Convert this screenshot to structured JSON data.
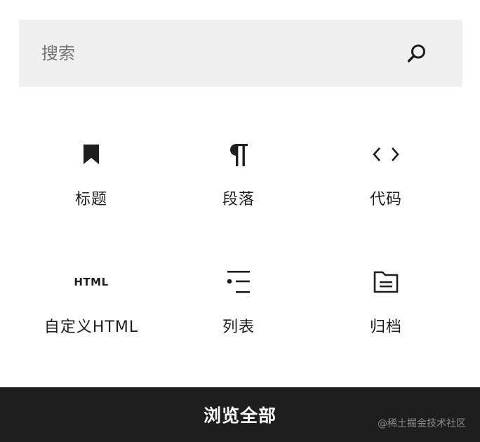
{
  "search": {
    "placeholder": "搜索",
    "icon": "search-icon"
  },
  "blocks": [
    {
      "label": "标题",
      "icon": "bookmark-icon"
    },
    {
      "label": "段落",
      "icon": "paragraph-icon"
    },
    {
      "label": "代码",
      "icon": "code-icon"
    },
    {
      "label": "自定义HTML",
      "icon": "html-icon",
      "icon_text": "HTML"
    },
    {
      "label": "列表",
      "icon": "list-icon"
    },
    {
      "label": "归档",
      "icon": "archive-folder-icon"
    }
  ],
  "footer": {
    "browse_all_label": "浏览全部",
    "watermark": "@稀土掘金技术社区"
  },
  "colors": {
    "text": "#1e1e1e",
    "search_bg": "#f0f0f0",
    "footer_bg": "#1e1e1e",
    "footer_text": "#ffffff"
  }
}
